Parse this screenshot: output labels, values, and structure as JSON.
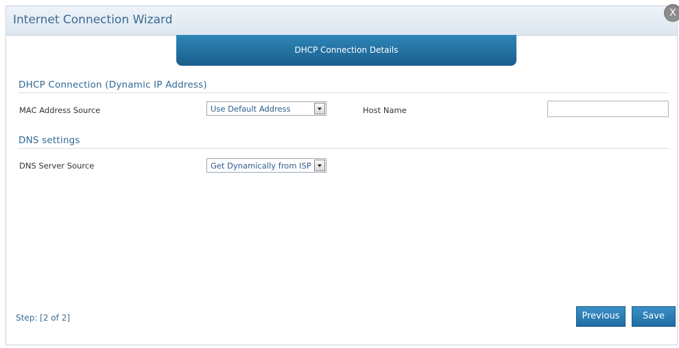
{
  "window": {
    "title": "Internet Connection Wizard",
    "close_label": "X"
  },
  "step_tab": {
    "label": "DHCP Connection Details"
  },
  "sections": {
    "dhcp": {
      "header": "DHCP Connection (Dynamic IP Address)",
      "mac_label": "MAC Address Source",
      "mac_value": "Use Default Address",
      "host_label": "Host Name",
      "host_value": ""
    },
    "dns": {
      "header": "DNS settings",
      "server_label": "DNS Server Source",
      "server_value": "Get Dynamically from ISP"
    }
  },
  "footer": {
    "step": "Step: [2 of 2]",
    "previous_label": "Previous",
    "save_label": "Save"
  }
}
